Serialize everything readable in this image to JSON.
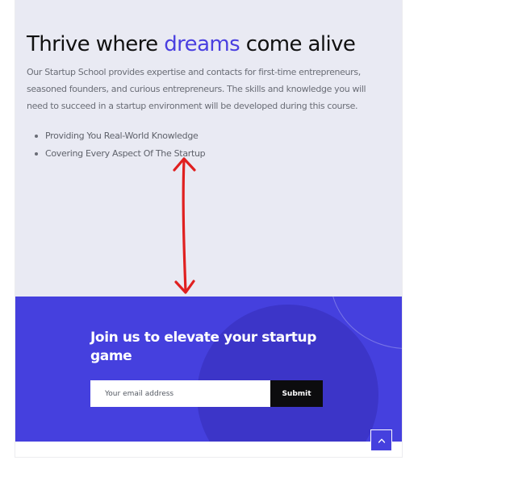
{
  "hero": {
    "title_before": "Thrive where ",
    "title_accent": "dreams",
    "title_after": " come alive",
    "paragraph": "Our Startup School provides expertise and contacts for first-time entrepreneurs, seasoned founders, and curious entrepreneurs. The skills and knowledge you will need to succeed in a startup environment will be developed during this course.",
    "bullets": [
      "Providing You Real-World Knowledge",
      "Covering Every Aspect Of The Startup"
    ]
  },
  "cta": {
    "title": "Join us to elevate your startup game",
    "email_placeholder": "Your email address",
    "submit_label": "Submit"
  },
  "icons": {
    "back_to_top": "chevron-up-icon",
    "annotation": "double-headed-arrow"
  },
  "colors": {
    "accent": "#4a3fe0",
    "hero_background": "#e9eaf3",
    "cta_background": "#4540de",
    "submit_background": "#0c0c0e",
    "annotation": "#e02020"
  }
}
